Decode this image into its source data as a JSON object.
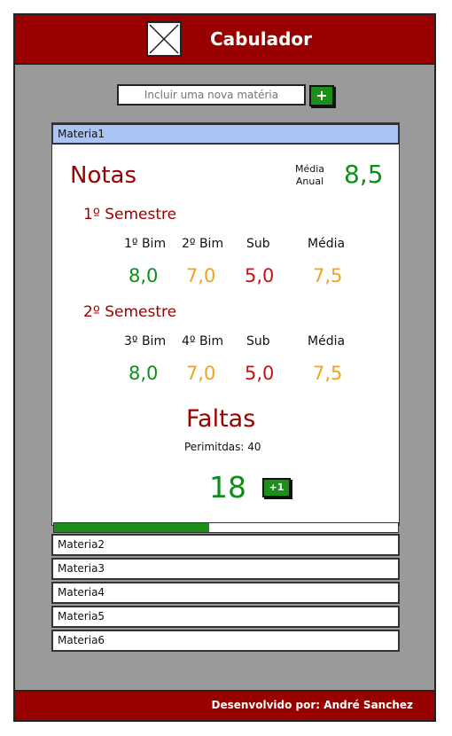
{
  "header": {
    "title": "Cabulador"
  },
  "add_subject": {
    "placeholder": "Incluir uma nova matéria",
    "button_label": "+"
  },
  "active_subject": {
    "name": "Materia1",
    "notas_label": "Notas",
    "media_anual_label_1": "Média",
    "media_anual_label_2": "Anual",
    "media_anual_value": "8,5",
    "semesters": [
      {
        "title": "1º Semestre",
        "headers": [
          "1º Bim",
          "2º Bim",
          "Sub",
          "Média"
        ],
        "values": [
          "8,0",
          "7,0",
          "5,0",
          "7,5"
        ]
      },
      {
        "title": "2º Semestre",
        "headers": [
          "3º Bim",
          "4º Bim",
          "Sub",
          "Média"
        ],
        "values": [
          "8,0",
          "7,0",
          "5,0",
          "7,5"
        ]
      }
    ],
    "faltas": {
      "label": "Faltas",
      "allowed_text": "Perimitdas: 40",
      "count": "18",
      "add_button": "+1",
      "progress_fraction": 0.45
    }
  },
  "subjects": [
    "Materia2",
    "Materia3",
    "Materia4",
    "Materia5",
    "Materia6"
  ],
  "footer": {
    "text": "Desenvolvido por: André Sanchez"
  },
  "colors": {
    "brand_red": "#990000",
    "grade_good": "#0d8f1a",
    "grade_mid": "#f2a31b",
    "grade_bad": "#cc1111",
    "selected_tab": "#a9c4f5",
    "frame_gray": "#9a9a9a"
  },
  "icons": [
    "image-placeholder-icon"
  ]
}
